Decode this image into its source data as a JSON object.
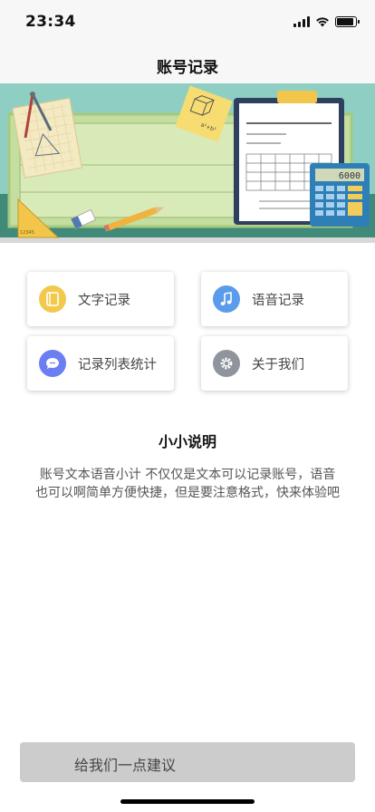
{
  "status_bar": {
    "time": "23:34",
    "signal_icon": "cellular-signal-icon",
    "wifi_icon": "wifi-icon",
    "battery_icon": "battery-icon",
    "battery_level": 0.9
  },
  "nav": {
    "title": "账号记录"
  },
  "banner": {
    "calculator_display": "6000",
    "triangle_ruler_marks": "12345",
    "math_sketch_text": "a²+b²"
  },
  "menu": {
    "items": [
      {
        "label": "文字记录",
        "icon": "notebook-icon",
        "color": "#f2c94c"
      },
      {
        "label": "语音记录",
        "icon": "music-note-icon",
        "color": "#5b9bec"
      },
      {
        "label": "记录列表统计",
        "icon": "chat-bubble-icon",
        "color": "#6c7ff2"
      },
      {
        "label": "关于我们",
        "icon": "gear-icon",
        "color": "#8f949d"
      }
    ]
  },
  "note": {
    "title": "小小说明",
    "body": "账号文本语音小计 不仅仅是文本可以记录账号，语音也可以啊简单方便快捷，但是要注意格式，快来体验吧"
  },
  "suggest": {
    "label": "给我们一点建议"
  }
}
